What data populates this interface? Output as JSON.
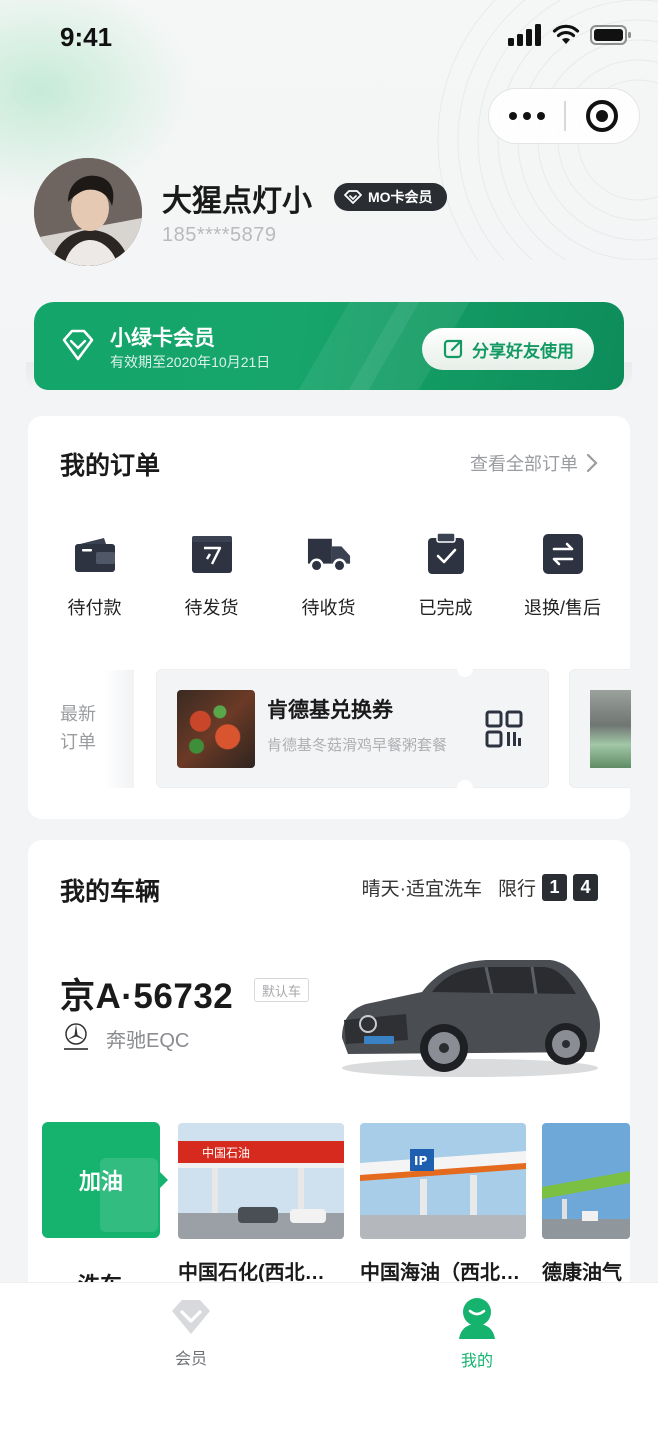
{
  "status_bar": {
    "time": "9:41"
  },
  "profile": {
    "name": "大猩点灯小",
    "badge": "MO卡会员",
    "phone": "185****5879"
  },
  "member_card": {
    "title": "小绿卡会员",
    "expiry": "有效期至2020年10月21日",
    "share_label": "分享好友使用"
  },
  "orders": {
    "title": "我的订单",
    "view_all": "查看全部订单",
    "statuses": [
      {
        "label": "待付款",
        "icon": "wallet-icon"
      },
      {
        "label": "待发货",
        "icon": "package-icon"
      },
      {
        "label": "待收货",
        "icon": "delivery-truck-icon"
      },
      {
        "label": "已完成",
        "icon": "clipboard-check-icon"
      },
      {
        "label": "退换/售后",
        "icon": "exchange-icon"
      }
    ],
    "latest_label": "最新订单",
    "latest": {
      "title": "肯德基兑换券",
      "subtitle": "肯德基冬菇滑鸡早餐粥套餐"
    }
  },
  "vehicle": {
    "title": "我的车辆",
    "weather": "晴天·适宜洗车",
    "limit_label": "限行",
    "limit_numbers": [
      "1",
      "4"
    ],
    "plate": "京A·56732",
    "default_tag": "默认车",
    "model": "奔驰EQC",
    "tabs": {
      "active": "加油",
      "next": "洗车"
    },
    "stations": [
      {
        "name": "中国石化(西北旺加油站)"
      },
      {
        "name": "中国海油（西北旺加油站）"
      },
      {
        "name": "德康油气"
      }
    ]
  },
  "tabbar": {
    "items": [
      {
        "label": "会员",
        "active": false
      },
      {
        "label": "我的",
        "active": true
      }
    ]
  },
  "colors": {
    "brand_green": "#16b36f",
    "dark": "#2a2e33",
    "muted": "#9a9ca0"
  }
}
